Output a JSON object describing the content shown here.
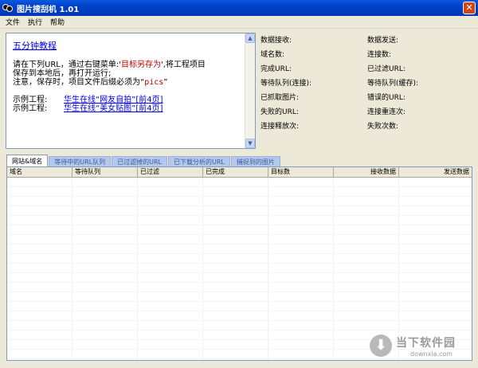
{
  "window": {
    "title": "图片搜刮机 1.01",
    "close_glyph": "✕"
  },
  "menubar": {
    "items": [
      "文件",
      "执行",
      "帮助"
    ]
  },
  "help": {
    "title": "五分钟教程",
    "line1_a": "请在下列URL，通过右键菜单:'",
    "line1_red": "目标另存为",
    "line1_b": "',将工程项目",
    "line2": "保存到本地后，再打开运行;",
    "line3_a": "注意，保存时，项目文件后缀必须为“",
    "line3_ext": "pics",
    "line3_b": "”",
    "examples": [
      {
        "label": "示例工程:",
        "link": "华生在线“网友自拍”[前4页]"
      },
      {
        "label": "示例工程:",
        "link": "华生在线“美女贴图”[前4页]"
      }
    ],
    "scroll_up": "▲",
    "scroll_down": "▼"
  },
  "stats": {
    "left": [
      "数据接收:",
      "域名数:",
      "完成URL:",
      "等待队列(连接):",
      "已抓取图片:",
      "失败的URL:",
      "连接释放次:"
    ],
    "right": [
      "数据发送:",
      "连接数:",
      "已过滤URL:",
      "等待队列(缓存):",
      "错误的URL:",
      "连接重连次:",
      "失败次数:"
    ]
  },
  "tabs": [
    "网站&域名",
    "等待中的URL队列",
    "已过滤掉的URL",
    "已下载分析的URL",
    "捕捉到的图片"
  ],
  "active_tab": 0,
  "grid": {
    "columns": [
      "域名",
      "等待队列",
      "已过滤",
      "已完成",
      "目标数",
      "接收数据",
      "发送数据"
    ]
  },
  "watermark": {
    "icon": "⬇",
    "cn": "当下软件园",
    "en": "downxia.com"
  },
  "colors": {
    "titlebar": "#0a58e0",
    "link": "#0000ee",
    "red_text": "#c00000",
    "active_tab": "#fcfcfe",
    "inactive_tab": "#b4c8ec"
  }
}
